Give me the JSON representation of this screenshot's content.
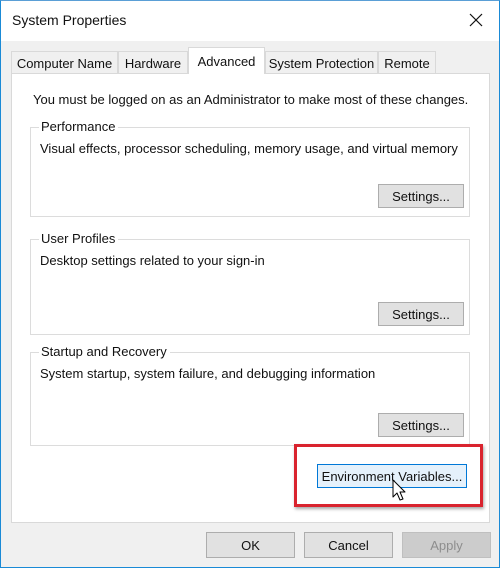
{
  "window": {
    "title": "System Properties",
    "close_icon": "close-x-icon"
  },
  "tabs": [
    {
      "label": "Computer Name",
      "active": false
    },
    {
      "label": "Hardware",
      "active": false
    },
    {
      "label": "Advanced",
      "active": true
    },
    {
      "label": "System Protection",
      "active": false
    },
    {
      "label": "Remote",
      "active": false
    }
  ],
  "advanced": {
    "admin_note": "You must be logged on as an Administrator to make most of these changes.",
    "groups": [
      {
        "label": "Performance",
        "description": "Visual effects, processor scheduling, memory usage, and virtual memory",
        "button": "Settings..."
      },
      {
        "label": "User Profiles",
        "description": "Desktop settings related to your sign-in",
        "button": "Settings..."
      },
      {
        "label": "Startup and Recovery",
        "description": "System startup, system failure, and debugging information",
        "button": "Settings..."
      }
    ],
    "env_button": "Environment Variables..."
  },
  "footer": {
    "ok": "OK",
    "cancel": "Cancel",
    "apply": "Apply",
    "apply_disabled": true
  },
  "annotation": {
    "highlight_color": "#d9232e",
    "highlighted_target": "Environment Variables..."
  }
}
